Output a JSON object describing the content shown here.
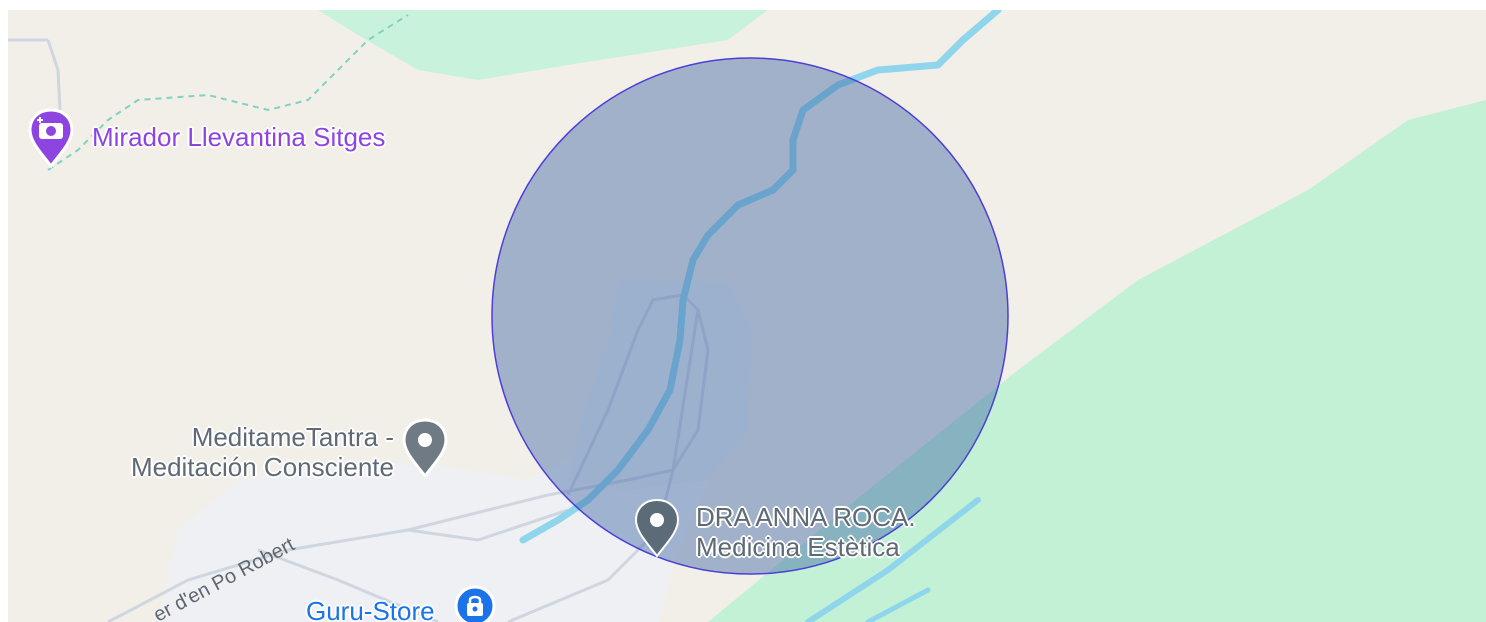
{
  "map": {
    "colors": {
      "land": "#f2efe9",
      "park": "#c3f1d5",
      "water": "#8fd6ec",
      "road": "#ffffff",
      "urban": "#eef0f3",
      "circle_fill": "#3f67a3",
      "circle_stroke": "#4b3fd6",
      "poi_purple": "#8e44e0",
      "poi_gray": "#5f6a75",
      "poi_blue": "#1a73e8",
      "trail": "#7fd3c0"
    },
    "search_circle": {
      "shape": "circle",
      "fill_opacity": 0.45
    },
    "pois": [
      {
        "name": "Mirador Llevantina Sitges",
        "icon": "camera-icon",
        "category_color": "#8e44e0"
      },
      {
        "name_line1": "MeditameTantra -",
        "name_line2": "Meditación Consciente",
        "icon": "location-dot-icon",
        "category_color": "#5f6a75"
      },
      {
        "name_line1": "DRA ANNA ROCA.",
        "name_line2": "Medicina Estètica",
        "icon": "location-dot-icon",
        "category_color": "#5f6a75"
      },
      {
        "name": "Guru-Store",
        "icon": "shopping-bag-icon",
        "category_color": "#1a73e8"
      }
    ],
    "streets": [
      {
        "name": "er d'en Po Robert"
      }
    ]
  }
}
